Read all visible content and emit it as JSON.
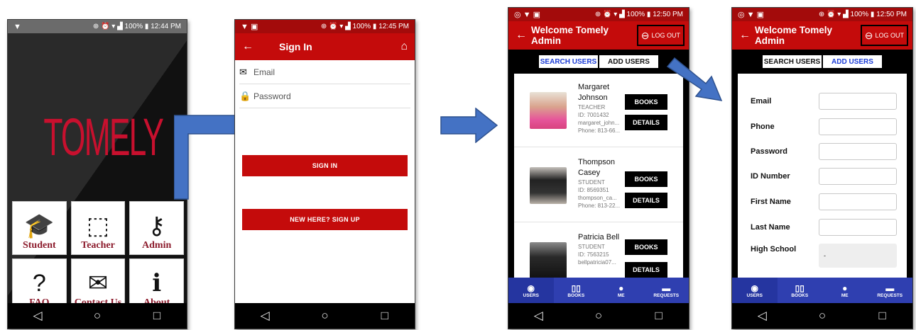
{
  "colors": {
    "brand_red": "#c40b0b",
    "admin_nav_blue": "#2f3fb0",
    "tab_active_blue": "#1a3bd6",
    "arrow_blue": "#4472c4"
  },
  "splash": {
    "status_time": "12:44 PM",
    "status_battery": "100%",
    "logo": "TOMELY",
    "tiles": [
      {
        "label": "Student",
        "icon": "graduate-icon"
      },
      {
        "label": "Teacher",
        "icon": "teacher-board-icon"
      },
      {
        "label": "Admin",
        "icon": "admin-key-icon"
      },
      {
        "label": "FAQ",
        "icon": "question-bubble-icon"
      },
      {
        "label": "Contact Us",
        "icon": "envelope-icon"
      },
      {
        "label": "About",
        "icon": "info-bubble-icon"
      }
    ]
  },
  "signin": {
    "status_time": "12:45 PM",
    "status_battery": "100%",
    "title": "Sign In",
    "email_placeholder": "Email",
    "password_placeholder": "Password",
    "signin_button": "SIGN IN",
    "signup_button": "NEW HERE? SIGN UP"
  },
  "admin_search": {
    "status_time": "12:50 PM",
    "status_battery": "100%",
    "title": "Welcome Tomely Admin",
    "logout": "LOG OUT",
    "tabs": [
      {
        "label": "SEARCH USERS",
        "active": true
      },
      {
        "label": "ADD USERS",
        "active": false
      }
    ],
    "users": [
      {
        "first": "Margaret",
        "last": "Johnson",
        "role": "TEACHER",
        "id": "ID: 7001432",
        "email": "margaret_john...",
        "phone": "Phone: 813-66..."
      },
      {
        "first": "Thompson",
        "last": "Casey",
        "role": "STUDENT",
        "id": "ID: 8569351",
        "email": "thompson_ca...",
        "phone": "Phone: 813-22..."
      },
      {
        "first": "Patricia",
        "last": "Bell",
        "role": "STUDENT",
        "id": "ID: 7563215",
        "email": "bellpatricia07...",
        "phone": ""
      }
    ],
    "books_button": "BOOKS",
    "details_button": "DETAILS",
    "bottom_nav": [
      {
        "label": "USERS",
        "icon": "github-icon",
        "active": true
      },
      {
        "label": "BOOKS",
        "icon": "book-icon",
        "active": false
      },
      {
        "label": "ME",
        "icon": "person-icon",
        "active": false
      },
      {
        "label": "REQUESTS",
        "icon": "chat-icon",
        "active": false
      }
    ]
  },
  "admin_add": {
    "status_time": "12:50 PM",
    "status_battery": "100%",
    "title": "Welcome Tomely Admin",
    "logout": "LOG OUT",
    "tabs": [
      {
        "label": "SEARCH USERS",
        "active": false
      },
      {
        "label": "ADD USERS",
        "active": true
      }
    ],
    "fields": [
      {
        "label": "Email",
        "value": ""
      },
      {
        "label": "Phone",
        "value": ""
      },
      {
        "label": "Password",
        "value": ""
      },
      {
        "label": "ID Number",
        "value": ""
      },
      {
        "label": "First Name",
        "value": ""
      },
      {
        "label": "Last Name",
        "value": ""
      },
      {
        "label": "High School",
        "value": "-"
      }
    ],
    "bottom_nav": [
      {
        "label": "USERS",
        "icon": "github-icon",
        "active": true
      },
      {
        "label": "BOOKS",
        "icon": "book-icon",
        "active": false
      },
      {
        "label": "ME",
        "icon": "person-icon",
        "active": false
      },
      {
        "label": "REQUESTS",
        "icon": "chat-icon",
        "active": false
      }
    ]
  },
  "system_nav": {
    "back": "◁",
    "home": "○",
    "recents": "□"
  }
}
